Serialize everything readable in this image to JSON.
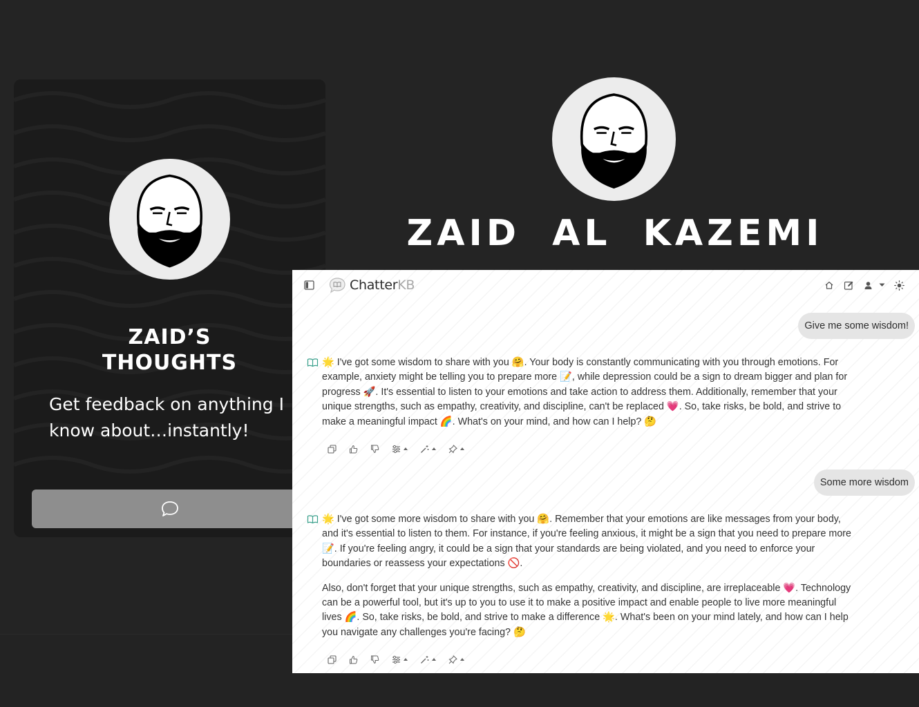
{
  "card": {
    "title_line1": "ZAID’S",
    "title_line2": "THOUGHTS",
    "subtitle": "Get feedback on anything I know about…instantly!",
    "chat_button_icon": "chat-bubble-icon"
  },
  "hero": {
    "name": "ZAID AL KAZEMI"
  },
  "chat": {
    "brand": {
      "main": "Chatter",
      "accent": "KB"
    },
    "toolbar_icons": [
      "sidebar-toggle-icon",
      "home-icon",
      "edit-icon",
      "user-icon",
      "sun-icon"
    ],
    "messages": [
      {
        "role": "user",
        "text": "Give me some wisdom!"
      },
      {
        "role": "assistant",
        "paragraphs": [
          "🌟 I've got some wisdom to share with you 🤗. Your body is constantly communicating with you through emotions. For example, anxiety might be telling you to prepare more 📝, while depression could be a sign to dream bigger and plan for progress 🚀. It's essential to listen to your emotions and take action to address them. Additionally, remember that your unique strengths, such as empathy, creativity, and discipline, can't be replaced 💗. So, take risks, be bold, and strive to make a meaningful impact 🌈. What's on your mind, and how can I help? 🤔"
        ]
      },
      {
        "role": "user",
        "text": "Some more wisdom"
      },
      {
        "role": "assistant",
        "paragraphs": [
          "🌟 I've got some more wisdom to share with you 🤗. Remember that your emotions are like messages from your body, and it's essential to listen to them. For instance, if you're feeling anxious, it might be a sign that you need to prepare more 📝. If you're feeling angry, it could be a sign that your standards are being violated, and you need to enforce your boundaries or reassess your expectations 🚫.",
          "Also, don't forget that your unique strengths, such as empathy, creativity, and discipline, are irreplaceable 💗. Technology can be a powerful tool, but it's up to you to use it to make a positive impact and enable people to live more meaningful lives 🌈. So, take risks, be bold, and strive to make a difference 🌟. What's been on your mind lately, and how can I help you navigate any challenges you're facing? 🤔"
        ]
      }
    ],
    "message_actions": [
      "copy-icon",
      "thumbs-up-icon",
      "thumbs-down-icon",
      "settings-sliders-icon",
      "magic-wand-icon",
      "pin-icon"
    ]
  }
}
